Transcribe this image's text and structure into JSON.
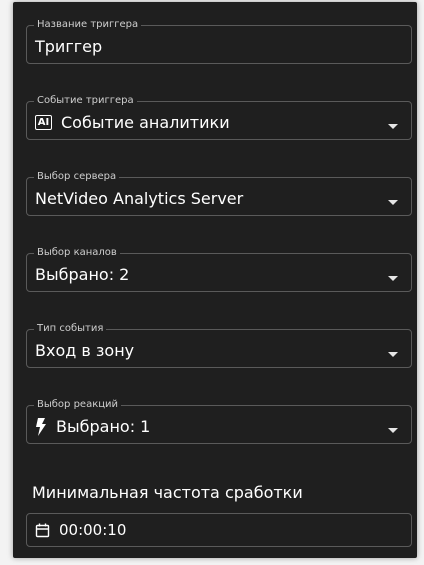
{
  "fields": [
    {
      "label": "Название триггера",
      "value": "Триггер",
      "icon": null,
      "dropdown": false
    },
    {
      "label": "Событие триггера",
      "value": "Событие аналитики",
      "icon": "ai-icon",
      "dropdown": true
    },
    {
      "label": "Выбор сервера",
      "value": "NetVideo Analytics Server",
      "icon": null,
      "dropdown": true
    },
    {
      "label": "Выбор каналов",
      "value": "Выбрано: 2",
      "icon": null,
      "dropdown": true
    },
    {
      "label": "Тип события",
      "value": "Вход в зону",
      "icon": null,
      "dropdown": true
    },
    {
      "label": "Выбор реакций",
      "value": "Выбрано: 1",
      "icon": "lightning-icon",
      "dropdown": true
    }
  ],
  "ai_icon_text": "AI",
  "frequency": {
    "label": "Минимальная частота сработки",
    "value": "00:00:10",
    "icon": "calendar-icon"
  }
}
